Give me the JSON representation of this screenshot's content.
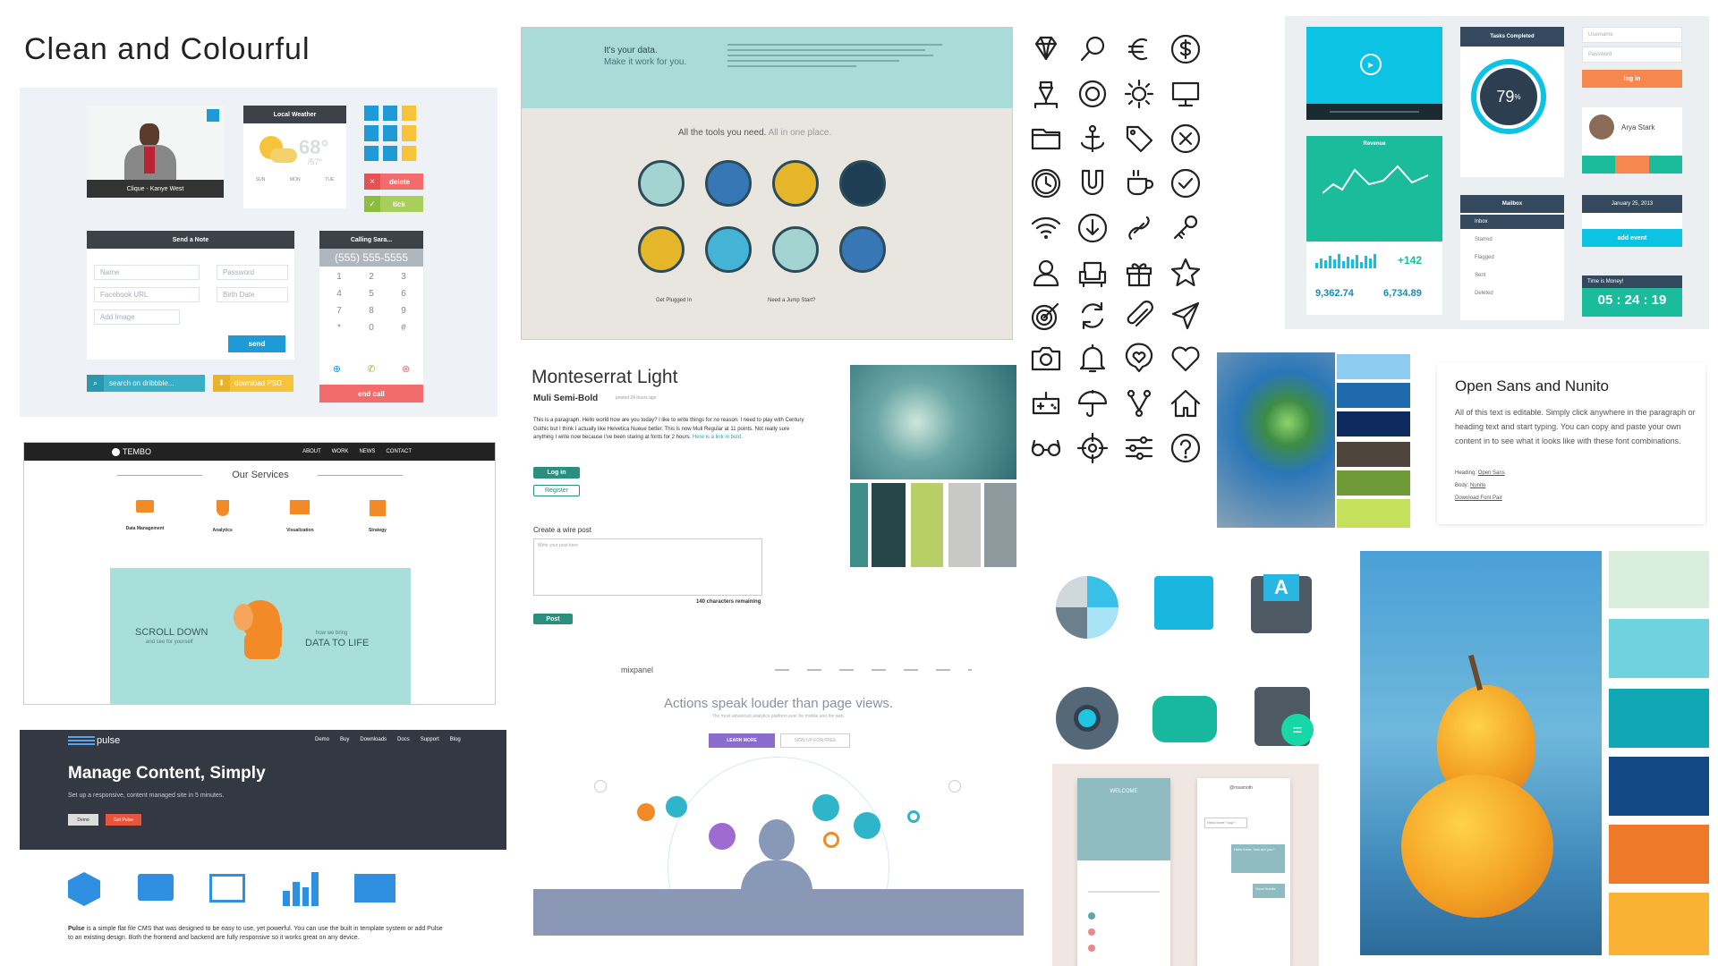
{
  "heading": "Clean and Colourful",
  "kit": {
    "video_caption": "Clique - Kanye West",
    "weather_title": "Local Weather",
    "weather_temp": "68°",
    "weather_low": "/57°",
    "days": [
      "SUN",
      "MON",
      "TUE"
    ],
    "delete_label": "delete",
    "tick_label": "tick",
    "note_title": "Send a Note",
    "name_ph": "Name",
    "password_ph": "Password",
    "facebook_ph": "Facebook URL",
    "birth_ph": "Birth Date",
    "add_image": "Add Image",
    "send_label": "send",
    "calling_title": "Calling Sara...",
    "phone_number": "(555) 555-5555",
    "keys": [
      "1",
      "2",
      "3",
      "4",
      "5",
      "6",
      "7",
      "8",
      "9",
      "*",
      "0",
      "#"
    ],
    "end_call": "end call",
    "search_ph": "search on dribbble...",
    "download_label": "download PSD"
  },
  "data_panel": {
    "title": "It's your data.",
    "subtitle": "Make it work for you.",
    "tools_title": "All the tools you need.",
    "tools_sub": "All in one place.",
    "col1_title": "Get Plugged In",
    "col2_title": "Need a Jump Start?"
  },
  "dashboard": {
    "tasks_title": "Tasks Completed",
    "tasks_percent": "79",
    "tasks_unit": "%",
    "username_ph": "Username",
    "password_ph": "Password",
    "login_label": "log in",
    "profile_name": "Arya Stark",
    "revenue_title": "Revenue",
    "big_delta": "+142",
    "stat1": "9,362.74",
    "stat2": "6,734.89",
    "mailbox_title": "Mailbox",
    "mail_items": [
      "Inbox",
      "Starred",
      "Flagged",
      "Sent",
      "Deleted"
    ],
    "date_title": "January 25, 2013",
    "add_event": "add event",
    "timer_title": "Time is Money!",
    "timer_value": "05 : 24 : 19",
    "colors": {
      "teal": "#1ABC9C",
      "cyan": "#0DC3E4",
      "orange": "#F5874F",
      "dark": "#34495E"
    }
  },
  "tembo": {
    "brand": "TEMBO",
    "nav": [
      "ABOUT",
      "WORK",
      "NEWS",
      "CONTACT"
    ],
    "services_title": "Our Services",
    "services": [
      "Data Management",
      "Analytics",
      "Visualization",
      "Strategy"
    ],
    "scroll_title": "SCROLL DOWN",
    "scroll_sub": "and see for yourself",
    "bring_pre": "how we bring",
    "bring_title": "DATA TO LIFE"
  },
  "typo": {
    "title": "Monteserrat Light",
    "subtitle": "Muli Semi-Bold",
    "posted": "posted 24 hours ago",
    "paragraph": "This is a paragraph. Hello world how are you today? I like to write things for no reason. I need to play with Century Gothic but I think I actually like Helvetica Nueue better. This is now Muli Regular at 11 points. Not really sure anything I write now because I've been staring at fonts for 2 hours.",
    "link_text": "Here is a link in bold.",
    "login_label": "Log in",
    "register_label": "Register",
    "wire_title": "Create a wire post",
    "wire_ph": "Write your post here",
    "remaining": "140 characters remaining",
    "post_label": "Post"
  },
  "opensans": {
    "title": "Open Sans and Nunito",
    "body": "All of this text is editable. Simply click anywhere in the paragraph or heading text and start typing. You can copy and paste your own content in to see what it looks like with these font combinations.",
    "heading_label": "Heading:",
    "heading_font": "Open Sans",
    "body_label": "Body:",
    "body_font": "Nunito",
    "download": "Download Font Pair"
  },
  "pulse": {
    "brand": "pulse",
    "nav": [
      "Demo",
      "Buy",
      "Downloads",
      "Docs",
      "Support",
      "Blog"
    ],
    "headline": "Manage Content, Simply",
    "sub": "Set up a responsive, content managed site in 5 minutes.",
    "demo_label": "Demo",
    "get_label": "Get Pulse",
    "desc_bold": "Pulse",
    "desc": " is a simple flat file CMS that was designed to be easy to use, yet powerful. You can use the built in template system or add Pulse to an existing design. Both the frontend and backend are fully responsive so it works great on any device."
  },
  "mixpanel": {
    "brand": "mixpanel",
    "headline": "Actions speak louder than page views.",
    "sub": "The most advanced analytics platform ever for mobile and the web.",
    "learn_label": "LEARN MORE",
    "signup_label": "SIGN UP FOR FREE"
  },
  "phones": {
    "welcome": "WELCOME",
    "chat_title": "@rosamoth",
    "bubbles": [
      "Hello there? sup?",
      "Hello there, how are you?",
      "Good thanks"
    ]
  },
  "icon_names": [
    "diamond",
    "search",
    "euro",
    "dollar",
    "pen",
    "lifebuoy",
    "sun",
    "monitor",
    "folder",
    "anchor",
    "tag",
    "close-circle",
    "clock",
    "magnet",
    "coffee",
    "check-circle",
    "wifi",
    "download",
    "link",
    "key",
    "user",
    "armchair",
    "gift",
    "star",
    "target",
    "refresh",
    "paperclip",
    "send",
    "camera",
    "bell",
    "chat-heart",
    "heart",
    "gamepad",
    "umbrella",
    "fork",
    "home",
    "glasses",
    "crosshair",
    "sliders",
    "help"
  ],
  "palettes": {
    "dandelion": [
      "#3D8E88",
      "#264749",
      "#B8CF67",
      "#C8C9C6",
      "#8C9A9E"
    ],
    "leaf": [
      "#8ECBF0",
      "#1F6AAD",
      "#0E2A5C",
      "#4E453D",
      "#6E9B35",
      "#C4E05C"
    ],
    "pear": [
      "#D9EEDC",
      "#6FD3DF",
      "#11A7B4",
      "#124A85",
      "#EE7A29",
      "#F9B233"
    ]
  }
}
